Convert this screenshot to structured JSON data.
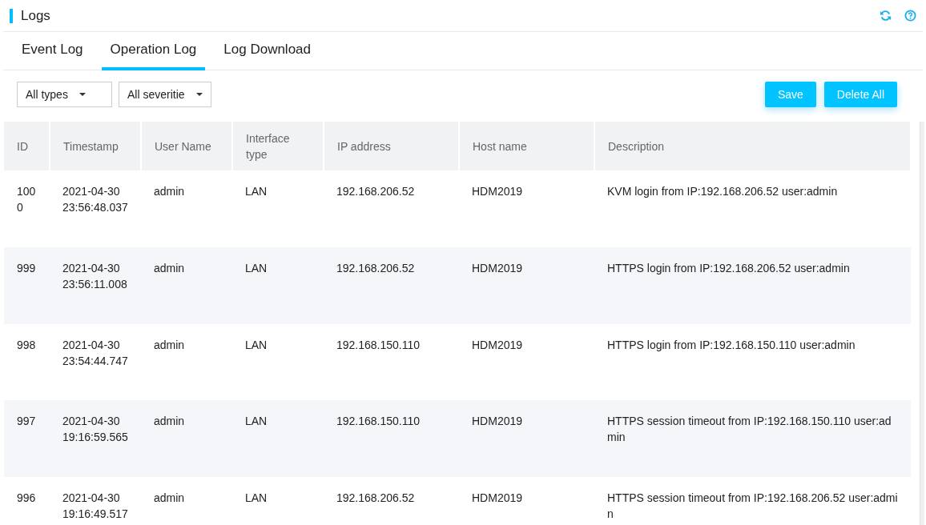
{
  "page_title": "Logs",
  "tabs": [
    {
      "label": "Event Log",
      "selected": false
    },
    {
      "label": "Operation Log",
      "selected": true
    },
    {
      "label": "Log Download",
      "selected": false
    }
  ],
  "filters": [
    {
      "label": "All types"
    },
    {
      "label": "All severitie"
    }
  ],
  "buttons": [
    "Save",
    "Delete All"
  ],
  "table": {
    "columns": [
      "ID",
      "Timestamp",
      "User Name",
      "Interface type",
      "IP address",
      "Host name",
      "Description"
    ],
    "rows": [
      [
        "1000",
        "2021-04-30 23:56:48.037",
        "admin",
        "LAN",
        "192.168.206.52",
        "HDM2019",
        "KVM login from IP:192.168.206.52 user:admin"
      ],
      [
        "999",
        "2021-04-30 23:56:11.008",
        "admin",
        "LAN",
        "192.168.206.52",
        "HDM2019",
        "HTTPS login from IP:192.168.206.52 user:admin"
      ],
      [
        "998",
        "2021-04-30 23:54:44.747",
        "admin",
        "LAN",
        "192.168.150.110",
        "HDM2019",
        "HTTPS login from IP:192.168.150.110 user:admin"
      ],
      [
        "997",
        "2021-04-30 19:16:59.565",
        "admin",
        "LAN",
        "192.168.150.110",
        "HDM2019",
        "HTTPS session timeout from IP:192.168.150.110 user:admin"
      ],
      [
        "996",
        "2021-04-30 19:16:49.517",
        "admin",
        "LAN",
        "192.168.206.52",
        "HDM2019",
        "HTTPS session timeout from IP:192.168.206.52 user:admin"
      ]
    ]
  }
}
